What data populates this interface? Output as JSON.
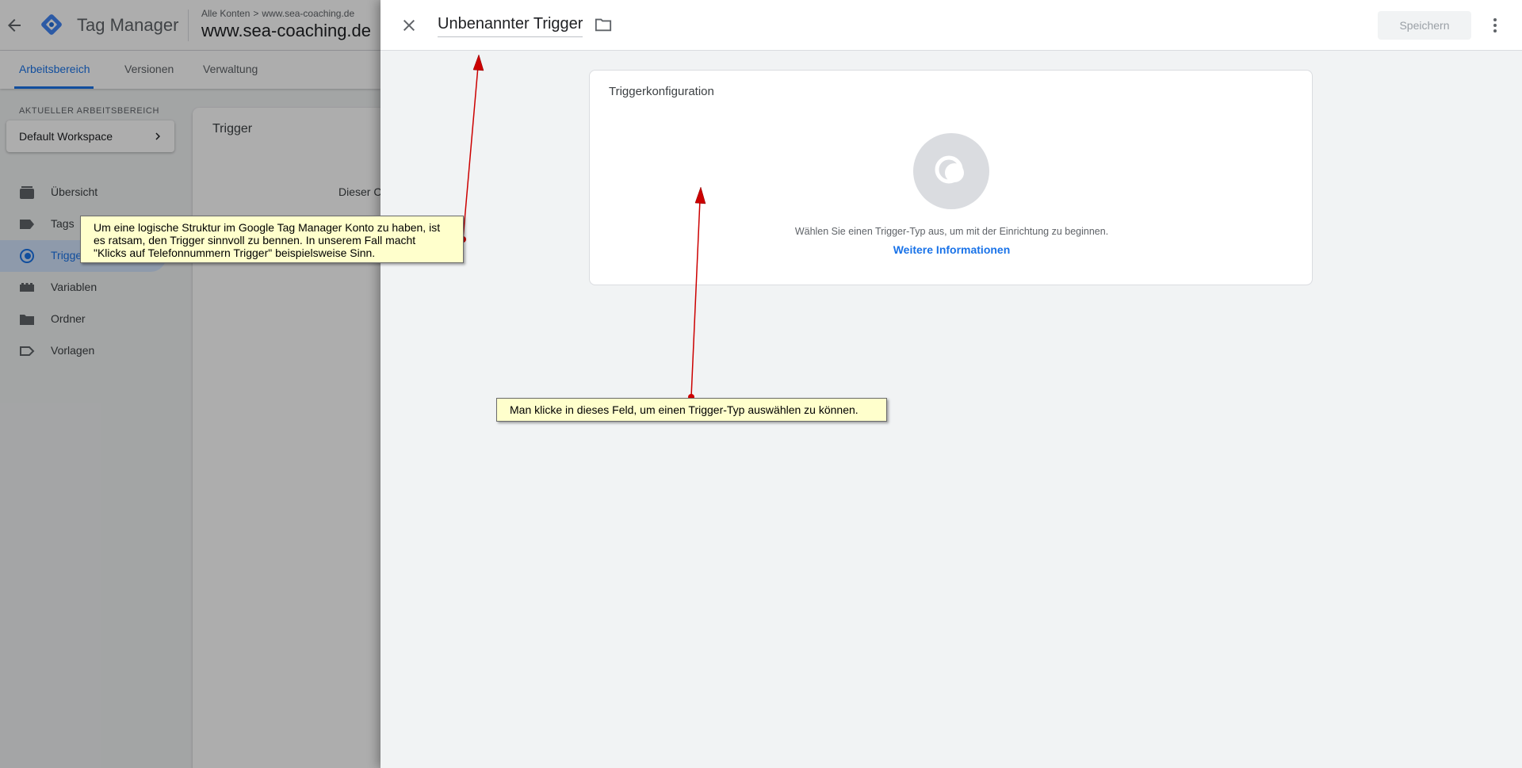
{
  "gtm": {
    "app_title": "Tag Manager",
    "breadcrumb": {
      "all_accounts": "Alle Konten",
      "separator": ">",
      "account": "www.sea-coaching.de"
    },
    "container_title": "www.sea-coaching.de",
    "nav_tabs": [
      {
        "label": "Arbeitsbereich",
        "active": true
      },
      {
        "label": "Versionen",
        "active": false
      },
      {
        "label": "Verwaltung",
        "active": false
      }
    ],
    "workspace_label": "AKTUELLER ARBEITSBEREICH",
    "workspace_name": "Default Workspace",
    "sidebar": [
      {
        "label": "Übersicht",
        "icon": "overview-icon",
        "active": false
      },
      {
        "label": "Tags",
        "icon": "tag-icon",
        "active": false
      },
      {
        "label": "Trigger",
        "icon": "trigger-icon",
        "active": true
      },
      {
        "label": "Variablen",
        "icon": "variables-icon",
        "active": false
      },
      {
        "label": "Ordner",
        "icon": "folder-icon",
        "active": false
      },
      {
        "label": "Vorlagen",
        "icon": "templates-icon",
        "active": false
      }
    ],
    "main_card": {
      "title": "Trigger",
      "text": "Dieser C"
    }
  },
  "panel": {
    "title": "Unbenannter Trigger",
    "save_label": "Speichern",
    "config": {
      "title": "Triggerkonfiguration",
      "hint": "Wählen Sie einen Trigger-Typ aus, um mit der Einrichtung zu beginnen.",
      "link": "Weitere Informationen"
    }
  },
  "annotations": {
    "callout_1": "Um eine logische Struktur im Google Tag Manager Konto zu haben, ist es ratsam, den Trigger sinnvoll zu bennen. In unserem Fall macht \"Klicks auf Telefonnummern Trigger\" beispielsweise Sinn.",
    "callout_2": "Man klicke in dieses Feld, um einen Trigger-Typ auswählen zu können."
  },
  "colors": {
    "accent": "#1a73e8",
    "callout_bg": "#ffffcc",
    "arrow": "#cc0000",
    "gtm_logo": "#4285f4"
  }
}
